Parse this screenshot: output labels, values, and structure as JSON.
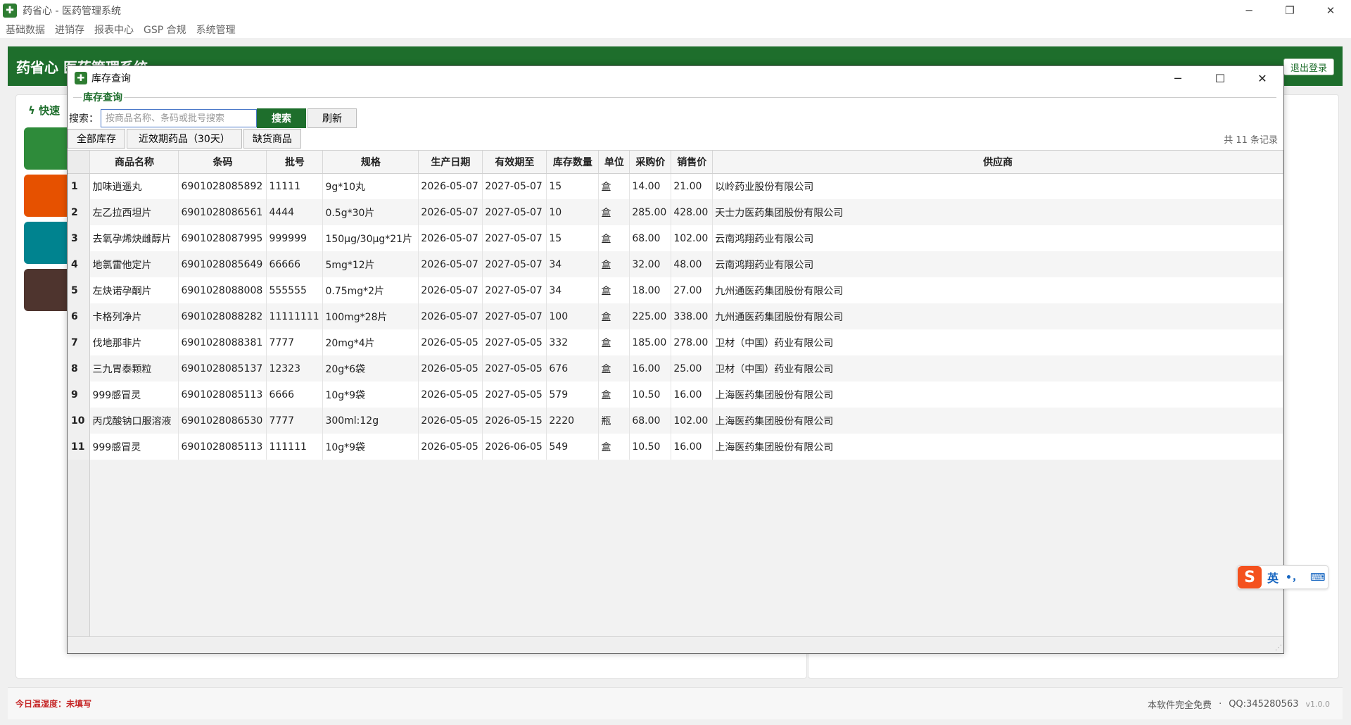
{
  "window": {
    "title": "药省心 - 医药管理系统",
    "icon": "plus-cross-icon"
  },
  "menu": [
    "基础数据",
    "进销存",
    "报表中心",
    "GSP 合规",
    "系统管理"
  ],
  "header": {
    "brand": "药省心  医药管理系统",
    "logout": "退出登录"
  },
  "quick": {
    "label": "快速"
  },
  "footer": {
    "temp_label": "今日温湿度：未填写",
    "free": "本软件完全免费",
    "qq": "QQ:345280563",
    "version": "v1.0.0"
  },
  "dialog": {
    "title": "库存查询",
    "group": "库存查询",
    "search_label": "搜索：",
    "search_placeholder": "按商品名称、条码或批号搜索",
    "search_btn": "搜索",
    "refresh_btn": "刷新",
    "tabs": [
      "全部库存",
      "近效期药品（30天）",
      "缺货商品"
    ],
    "record_count": "共 11 条记录",
    "columns": [
      "商品名称",
      "条码",
      "批号",
      "规格",
      "生产日期",
      "有效期至",
      "库存数量",
      "单位",
      "采购价",
      "销售价",
      "供应商"
    ],
    "rows": [
      [
        "1",
        "加味逍遥丸",
        "6901028085892",
        "11111",
        "9g*10丸",
        "2026-05-07",
        "2027-05-07",
        "15",
        "盒",
        "14.00",
        "21.00",
        "以岭药业股份有限公司"
      ],
      [
        "2",
        "左乙拉西坦片",
        "6901028086561",
        "4444",
        "0.5g*30片",
        "2026-05-07",
        "2027-05-07",
        "10",
        "盒",
        "285.00",
        "428.00",
        "天士力医药集团股份有限公司"
      ],
      [
        "3",
        "去氧孕烯炔雌醇片",
        "6901028087995",
        "999999",
        "150μg/30μg*21片",
        "2026-05-07",
        "2027-05-07",
        "15",
        "盒",
        "68.00",
        "102.00",
        "云南鸿翔药业有限公司"
      ],
      [
        "4",
        "地氯雷他定片",
        "6901028085649",
        "66666",
        "5mg*12片",
        "2026-05-07",
        "2027-05-07",
        "34",
        "盒",
        "32.00",
        "48.00",
        "云南鸿翔药业有限公司"
      ],
      [
        "5",
        "左炔诺孕酮片",
        "6901028088008",
        "555555",
        "0.75mg*2片",
        "2026-05-07",
        "2027-05-07",
        "34",
        "盒",
        "18.00",
        "27.00",
        "九州通医药集团股份有限公司"
      ],
      [
        "6",
        "卡格列净片",
        "6901028088282",
        "11111111",
        "100mg*28片",
        "2026-05-07",
        "2027-05-07",
        "100",
        "盒",
        "225.00",
        "338.00",
        "九州通医药集团股份有限公司"
      ],
      [
        "7",
        "伐地那非片",
        "6901028088381",
        "7777",
        "20mg*4片",
        "2026-05-05",
        "2027-05-05",
        "332",
        "盒",
        "185.00",
        "278.00",
        "卫材（中国）药业有限公司"
      ],
      [
        "8",
        "三九胃泰颗粒",
        "6901028085137",
        "12323",
        "20g*6袋",
        "2026-05-05",
        "2027-05-05",
        "676",
        "盒",
        "16.00",
        "25.00",
        "卫材（中国）药业有限公司"
      ],
      [
        "9",
        "999感冒灵",
        "6901028085113",
        "6666",
        "10g*9袋",
        "2026-05-05",
        "2027-05-05",
        "579",
        "盒",
        "10.50",
        "16.00",
        "上海医药集团股份有限公司"
      ],
      [
        "10",
        "丙戊酸钠口服溶液",
        "6901028086530",
        "7777",
        "300ml:12g",
        "2026-05-05",
        "2026-05-15",
        "2220",
        "瓶",
        "68.00",
        "102.00",
        "上海医药集团股份有限公司"
      ],
      [
        "11",
        "999感冒灵",
        "6901028085113",
        "111111",
        "10g*9袋",
        "2026-05-05",
        "2026-06-05",
        "549",
        "盒",
        "10.50",
        "16.00",
        "上海医药集团股份有限公司"
      ]
    ]
  },
  "ime": {
    "logo": "S",
    "lang": "英",
    "punct": "•，",
    "keyboard_icon": "keyboard-icon"
  },
  "colors": {
    "brand_green": "#1e6e2c",
    "tile1": "#2e8b3a",
    "tile2": "#e65100",
    "tile3": "#00838f",
    "tile4": "#4e342e"
  }
}
